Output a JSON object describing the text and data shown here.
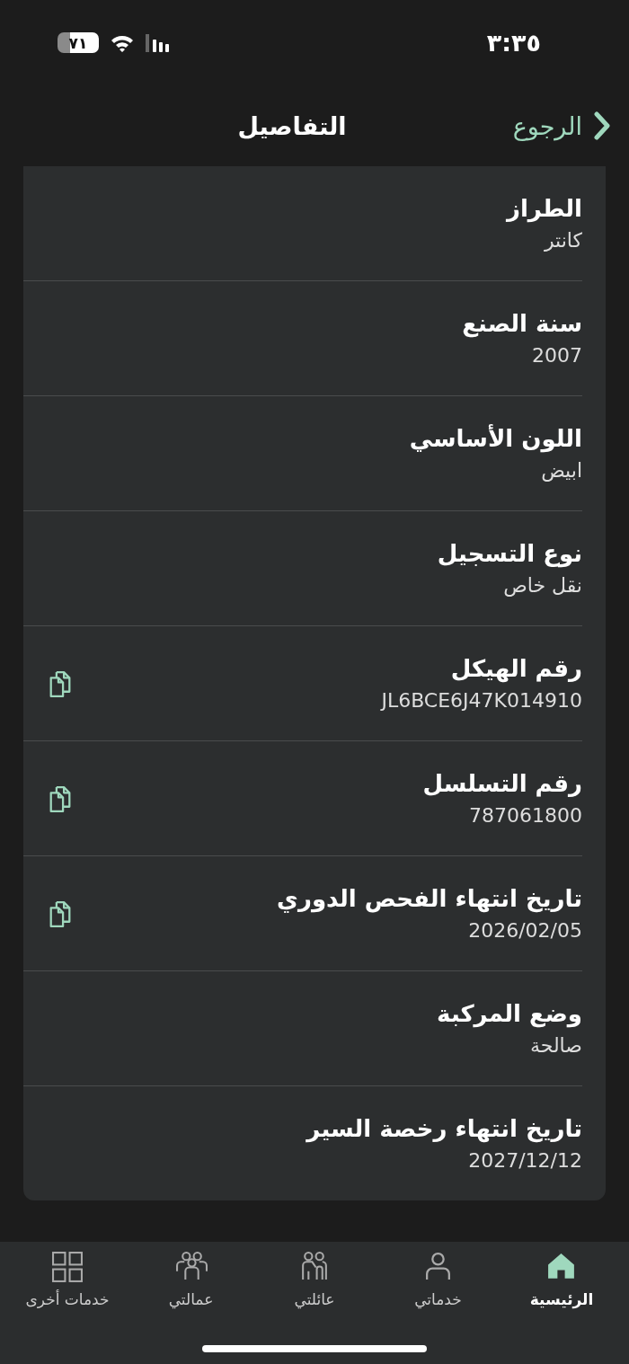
{
  "status_bar": {
    "time": "٣:٣٥",
    "battery": "٧١"
  },
  "header": {
    "back": "الرجوع",
    "title": "التفاصيل"
  },
  "details": [
    {
      "label": "الطراز",
      "value": "كانتر",
      "copyable": false
    },
    {
      "label": "سنة الصنع",
      "value": "2007",
      "copyable": false
    },
    {
      "label": "اللون الأساسي",
      "value": "ابيض",
      "copyable": false
    },
    {
      "label": "نوع التسجيل",
      "value": "نقل خاص",
      "copyable": false
    },
    {
      "label": "رقم الهيكل",
      "value": "JL6BCE6J47K014910",
      "copyable": true
    },
    {
      "label": "رقم التسلسل",
      "value": "787061800",
      "copyable": true
    },
    {
      "label": "تاريخ انتهاء الفحص الدوري",
      "value": "2026/02/05",
      "copyable": true
    },
    {
      "label": "وضع المركبة",
      "value": "صالحة",
      "copyable": false
    },
    {
      "label": "تاريخ انتهاء رخصة السير",
      "value": "2027/12/12",
      "copyable": false
    }
  ],
  "tab_bar": [
    {
      "label": "الرئيسية",
      "kind": "home",
      "selected": true
    },
    {
      "label": "خدماتي",
      "kind": "person",
      "selected": false
    },
    {
      "label": "عائلتي",
      "kind": "family",
      "selected": false
    },
    {
      "label": "عمالتي",
      "kind": "workers",
      "selected": false
    },
    {
      "label": "خدمات أخرى",
      "kind": "grid",
      "selected": false
    }
  ]
}
